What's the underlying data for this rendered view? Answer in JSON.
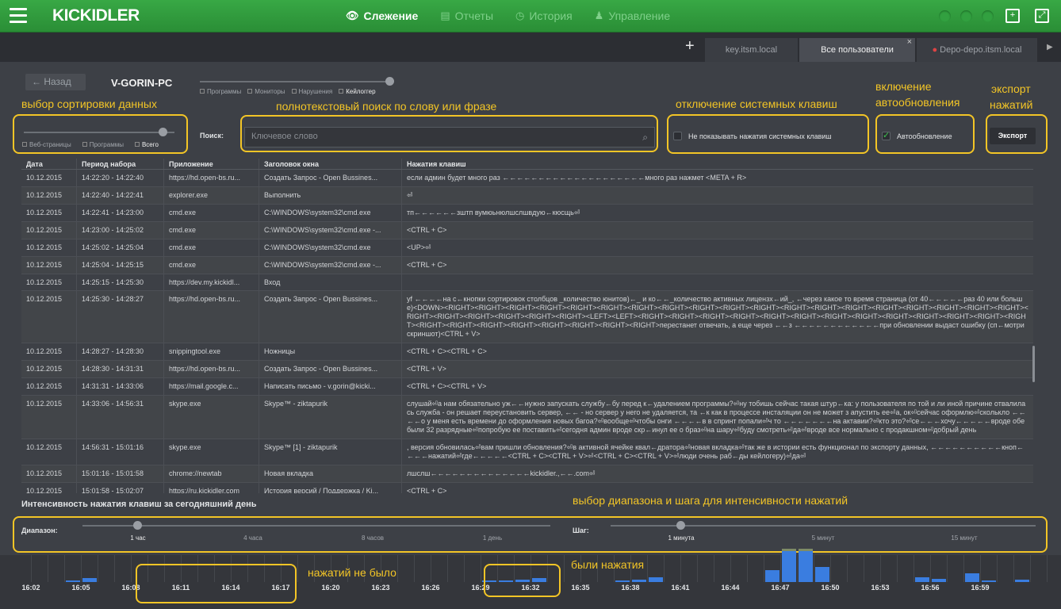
{
  "header": {
    "logo": "KICKIDLER",
    "nav": [
      {
        "label": "Слежение",
        "icon": "eye-icon",
        "glyph": "👁",
        "active": true
      },
      {
        "label": "Отчеты",
        "icon": "report-icon",
        "glyph": "▤",
        "active": false
      },
      {
        "label": "История",
        "icon": "history-icon",
        "glyph": "◷",
        "active": false
      },
      {
        "label": "Управление",
        "icon": "manage-icon",
        "glyph": "♟",
        "active": false
      }
    ]
  },
  "tabs": [
    {
      "label": "key.itsm.local",
      "active": false
    },
    {
      "label": "Все пользователи",
      "active": true,
      "close": "×"
    },
    {
      "label": "Depo-depo.itsm.local",
      "active": false
    }
  ],
  "page": {
    "back_label": "Назад",
    "pc_name": "V-GORIN-PC",
    "types": [
      {
        "label": "Программы",
        "selected": false
      },
      {
        "label": "Мониторы",
        "selected": false
      },
      {
        "label": "Нарушения",
        "selected": false
      },
      {
        "label": "Кейлоггер",
        "selected": true
      }
    ],
    "sort_options": [
      {
        "label": "Веб-страницы",
        "selected": false
      },
      {
        "label": "Программы",
        "selected": false
      },
      {
        "label": "Всего",
        "selected": true
      }
    ],
    "search_label": "Поиск:",
    "search_placeholder": "Ключевое слово",
    "system_keys_label": "Не показывать нажатия системных клавиш",
    "system_keys_checked": false,
    "autorefresh_label": "Автообновление",
    "autorefresh_checked": true,
    "export_label": "Экспорт"
  },
  "annotations": {
    "sort": "выбор сортировки данных",
    "search": "полнотекстовый поиск по слову или фразе",
    "system_keys": "отключение системных клавиш",
    "autorefresh_1": "включение",
    "autorefresh_2": "автообновления",
    "export_1": "экспорт",
    "export_2": "нажатий",
    "range": "выбор диапазона и шага для интенсивности нажатий",
    "no_presses": "нажатий не было",
    "presses": "были нажатия"
  },
  "table": {
    "headers": [
      "Дата",
      "Период набора",
      "Приложение",
      "Заголовок окна",
      "Нажатия клавиш"
    ],
    "rows": [
      [
        "10.12.2015",
        "14:22:20 - 14:22:40",
        "https://hd.open-bs.ru...",
        "Создать Запрос - Open Bussines...",
        "если админ будет много раз ←←←←←←←←←←←←←←←←←←←←много раз нажмет <META + R>"
      ],
      [
        "10.12.2015",
        "14:22:40 - 14:22:41",
        "explorer.exe",
        "Выполнить",
        "⏎"
      ],
      [
        "10.12.2015",
        "14:22:41 - 14:23:00",
        "cmd.exe",
        "C:\\WINDOWS\\system32\\cmd.exe",
        "тп←←←←←←зштп вумюьнюлшслшвдую←кюсщь⏎"
      ],
      [
        "10.12.2015",
        "14:23:00 - 14:25:02",
        "cmd.exe",
        "C:\\WINDOWS\\system32\\cmd.exe -...",
        "<CTRL + C>"
      ],
      [
        "10.12.2015",
        "14:25:02 - 14:25:04",
        "cmd.exe",
        "C:\\WINDOWS\\system32\\cmd.exe",
        "<UP>⏎"
      ],
      [
        "10.12.2015",
        "14:25:04 - 14:25:15",
        "cmd.exe",
        "C:\\WINDOWS\\system32\\cmd.exe -...",
        "<CTRL + C>"
      ],
      [
        "10.12.2015",
        "14:25:15 - 14:25:30",
        "https://dev.my.kickidl...",
        "Вход",
        ""
      ],
      [
        "10.12.2015",
        "14:25:30 - 14:28:27",
        "https://hd.open-bs.ru...",
        "Создать Запрос - Open Bussines...",
        "yf ←←←←на с←кнопки сортировок  столбцов _количество юнитов)←_ и ко←←_количество активных лицензх←ий_,  ←через какое то время страница  (от 40←←←←←раз 40 или больше)<DOWN><RIGHT><RIGHT><RIGHT><RIGHT><RIGHT><RIGHT><RIGHT><RIGHT><RIGHT><RIGHT><RIGHT><RIGHT><RIGHT><RIGHT><RIGHT><RIGHT><RIGHT><RIGHT><RIGHT><RIGHT><RIGHT><RIGHT><RIGHT><RIGHT><RIGHT><LEFT><LEFT><RIGHT><RIGHT><RIGHT><RIGHT><RIGHT><RIGHT><RIGHT><RIGHT><RIGHT><RIGHT><RIGHT><RIGHT><RIGHT><RIGHT><RIGHT><RIGHT><RIGHT><RIGHT><RIGHT><RIGHT><RIGHT>перестанет отвечать, а еще через ←←з ←←←←←←←←←←←←при обновлении выдаст ошибку (сп←мотри скриншот)<CTRL + V>"
      ],
      [
        "10.12.2015",
        "14:28:27 - 14:28:30",
        "snippingtool.exe",
        "Ножницы",
        "<CTRL + C><CTRL + C>"
      ],
      [
        "10.12.2015",
        "14:28:30 - 14:31:31",
        "https://hd.open-bs.ru...",
        "Создать Запрос - Open Bussines...",
        "<CTRL + V>"
      ],
      [
        "10.12.2015",
        "14:31:31 - 14:33:06",
        "https://mail.google.c...",
        "Написать письмо - v.gorin@kicki...",
        "<CTRL + C><CTRL + V>"
      ],
      [
        "10.12.2015",
        "14:33:06 - 14:56:31",
        "skype.exe",
        "Skype™ - ziktapurik",
        "слушай⏎а нам обязательно уж←←нужно запускать службу←бу перед к←удалением программы?⏎ну тобишь сейчас такая штур←ка: у пользователя по той и ли иной причине отвалилась служба - он решает переустановить сервер, ←← - но сервер у него не удаляется, та ←к как в процессе инсталяции он не может з апустить ее⏎а, ок⏎сейчас оформлю⏎сколькло ←←←←о у меня есть времени до оформления новых багоа?⏎вообще⏎чтобы онги ←←←←в в спринт попали⏎ч то ←←←←←←←на актавии?⏎кто это?⏎се←←←хочу←←←←←вроде обе были 32 разрядные⏎попробую ее поставить⏎сегодня админ вроде скр←инул ее о браз⏎на шару⏎буду смотреть⏎да⏎вроде все нормально с продакшном⏎добрый день"
      ],
      [
        "10.12.2015",
        "14:56:31 - 15:01:16",
        "skype.exe",
        "Skype™ [1] - ziktapurik",
        ", версия обновилась⏎вам пришли обновления?⏎в активной ячейке квал←дратора⏎новая вкладка⏎так же в истории есть функционал по экспорту данных, ←←←←←←←←←←кноп←←←←нажатий⏎где←←←←←<CTRL + C><CTRL + V>⏎<CTRL + C><CTRL + V>⏎люди очень раб←ды кейлогеру)⏎да⏎"
      ],
      [
        "10.12.2015",
        "15:01:16 - 15:01:58",
        "chrome://newtab",
        "Новая вкладка",
        "лшслш←←←←←←←←←←←←←←kickidler.,←←.com⏎"
      ],
      [
        "10.12.2015",
        "15:01:58 - 15:02:07",
        "https://ru.kickidler.com",
        "История версий / Поддержка / Ki...",
        "<CTRL + C>"
      ]
    ]
  },
  "intensity": {
    "title": "Интенсивность нажатия клавиш за сегодняшний день",
    "range_label": "Диапазон:",
    "range_options": [
      "1 час",
      "4 часа",
      "8 часов",
      "1 день"
    ],
    "range_selected": "1 час",
    "step_label": "Шаг:",
    "step_options": [
      "1 минута",
      "5 минут",
      "15 минут"
    ],
    "step_selected": "1 минута"
  },
  "chart_data": {
    "type": "bar",
    "x_ticks": [
      "16:02",
      "16:05",
      "16:08",
      "16:11",
      "16:14",
      "16:17",
      "16:20",
      "16:23",
      "16:26",
      "16:29",
      "16:32",
      "16:35",
      "16:38",
      "16:41",
      "16:44",
      "16:47",
      "16:50",
      "16:53",
      "16:56",
      "16:59"
    ],
    "bars": [
      {
        "minute": 4,
        "value": 0.05
      },
      {
        "minute": 5,
        "value": 0.12
      },
      {
        "minute": 29,
        "value": 0.05
      },
      {
        "minute": 30,
        "value": 0.05
      },
      {
        "minute": 31,
        "value": 0.08
      },
      {
        "minute": 32,
        "value": 0.12
      },
      {
        "minute": 37,
        "value": 0.05
      },
      {
        "minute": 38,
        "value": 0.08
      },
      {
        "minute": 39,
        "value": 0.15
      },
      {
        "minute": 46,
        "value": 0.35
      },
      {
        "minute": 47,
        "value": 1.0
      },
      {
        "minute": 48,
        "value": 1.0
      },
      {
        "minute": 49,
        "value": 0.45
      },
      {
        "minute": 55,
        "value": 0.15
      },
      {
        "minute": 56,
        "value": 0.1
      },
      {
        "minute": 58,
        "value": 0.25
      },
      {
        "minute": 59,
        "value": 0.05
      },
      {
        "minute": 61,
        "value": 0.08
      }
    ],
    "colors": {
      "bar": "#3a7de0",
      "cap": "#7f8c66"
    }
  }
}
